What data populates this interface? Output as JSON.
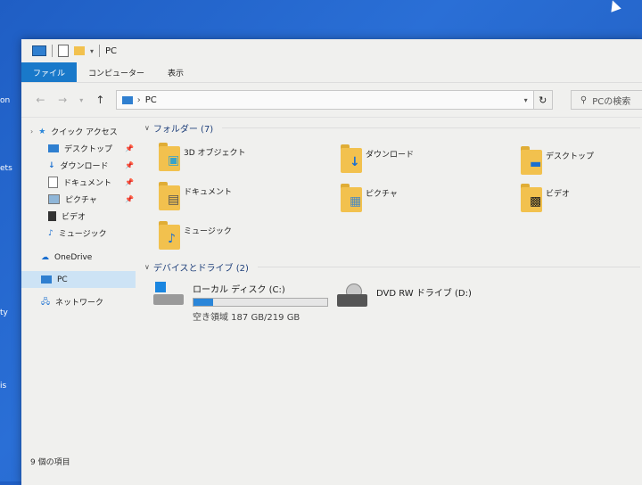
{
  "desktop_fragments": [
    "on",
    "ets",
    "ty",
    "is"
  ],
  "titlebar": {
    "title": "PC"
  },
  "ribbon": {
    "tabs": [
      "ファイル",
      "コンピューター",
      "表示"
    ],
    "active_index": 0
  },
  "address": {
    "path": "PC",
    "search_placeholder": "PCの検索"
  },
  "nav": {
    "quick_access": "クイック アクセス",
    "items": [
      {
        "label": "デスクトップ",
        "pinned": true
      },
      {
        "label": "ダウンロード",
        "pinned": true
      },
      {
        "label": "ドキュメント",
        "pinned": true
      },
      {
        "label": "ピクチャ",
        "pinned": true
      },
      {
        "label": "ビデオ",
        "pinned": false
      },
      {
        "label": "ミュージック",
        "pinned": false
      }
    ],
    "onedrive": "OneDrive",
    "pc": "PC",
    "network": "ネットワーク"
  },
  "folders_group": {
    "title": "フォルダー (7)",
    "items": [
      "3D オブジェクト",
      "ダウンロード",
      "デスクトップ",
      "ドキュメント",
      "ピクチャ",
      "ビデオ",
      "ミュージック"
    ]
  },
  "devices_group": {
    "title": "デバイスとドライブ (2)",
    "local": {
      "name": "ローカル ディスク (C:)",
      "free": "空き領域 187 GB/219 GB",
      "used_fraction": 0.146
    },
    "dvd": {
      "name": "DVD RW ドライブ (D:)"
    }
  },
  "status": {
    "text": "9 個の項目"
  },
  "colors": {
    "accent": "#1979ca",
    "folder": "#f2c14e",
    "selected": "#cde3f5"
  }
}
